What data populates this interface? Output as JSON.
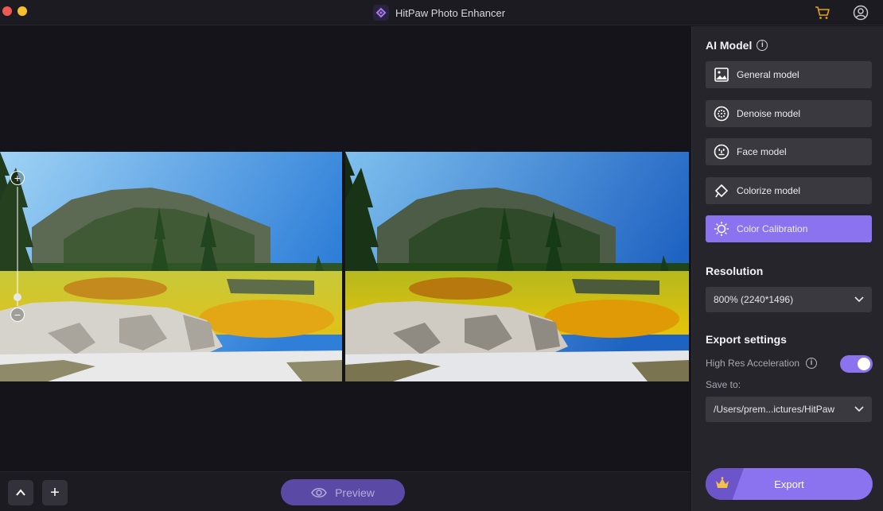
{
  "window": {
    "title": "HitPaw Photo Enhancer"
  },
  "colors": {
    "accent": "#8b72ee",
    "panel": "#26252c",
    "canvas": "#15141b",
    "cart": "#e4a11b"
  },
  "header": {
    "icons": [
      "cart-icon",
      "user-icon"
    ]
  },
  "canvas": {
    "zoom_in": "+",
    "zoom_out": "−",
    "zoom_level": 0.15
  },
  "bottom": {
    "collapse_label": "⌃",
    "add_label": "+",
    "preview_label": "Preview"
  },
  "panel": {
    "ai_model_title": "AI Model",
    "models": [
      {
        "label": "General model",
        "icon": "image-icon",
        "active": false
      },
      {
        "label": "Denoise model",
        "icon": "denoise-icon",
        "active": false
      },
      {
        "label": "Face model",
        "icon": "face-icon",
        "active": false
      },
      {
        "label": "Colorize model",
        "icon": "paint-bucket-icon",
        "active": false
      },
      {
        "label": "Color Calibration",
        "icon": "sun-icon",
        "active": true
      }
    ],
    "resolution_title": "Resolution",
    "resolution_value": "800% (2240*1496)",
    "export_settings_title": "Export settings",
    "high_res_label": "High Res Acceleration",
    "high_res_enabled": true,
    "save_to_label": "Save to:",
    "save_path": "/Users/prem...ictures/HitPaw",
    "export_label": "Export"
  }
}
